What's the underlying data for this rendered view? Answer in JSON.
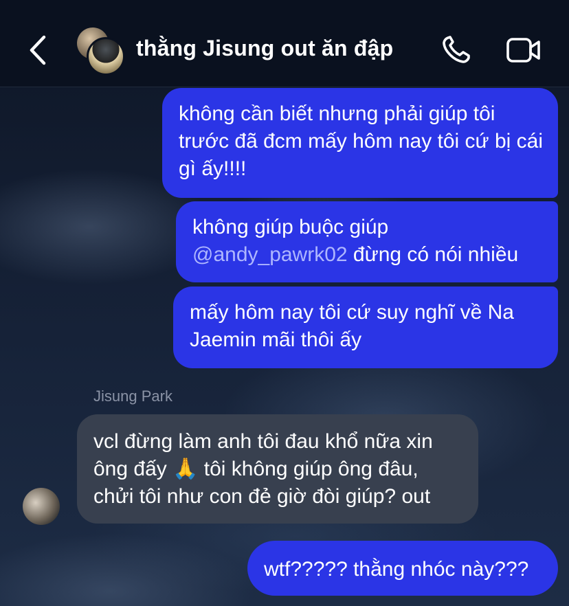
{
  "header": {
    "title": "thằng Jisung out ăn đập",
    "icons": [
      "back-chevron-icon",
      "call-icon",
      "video-call-icon"
    ]
  },
  "messages": {
    "m1": "không cần biết nhưng phải giúp tôi trước đã đcm mấy hôm nay tôi cứ bị cái gì ấy!!!!",
    "m2_text": "không giúp buộc giúp",
    "m2_mention": "@andy_pawrk02",
    "m2_rest": " đừng có nói nhiều",
    "m3": "mấy hôm nay tôi cứ suy nghĩ về Na Jaemin mãi thôi ấy",
    "reply_sender": "Jisung Park",
    "m4": "vcl đừng làm anh tôi đau khổ nữa xin ông đấy 🙏 tôi không giúp ông đâu, chửi tôi như con đẻ giờ đòi giúp? out",
    "m5": "wtf????? thằng nhóc này???"
  },
  "colors": {
    "outgoing_bubble": "#2b35e6",
    "incoming_bubble": "#38404f",
    "header_bg": "#0a111f",
    "mention": "#aeb6ff"
  }
}
